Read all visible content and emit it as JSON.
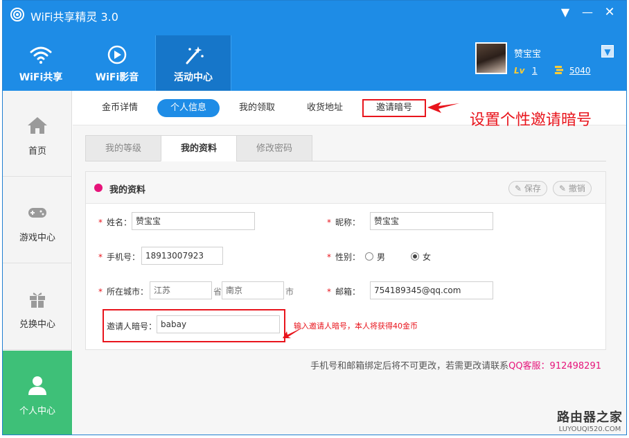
{
  "app": {
    "title": "WiFi共享精灵 3.0",
    "window_controls": {
      "dropdown": "▼",
      "minimize": "—",
      "close": "✕"
    }
  },
  "nav": [
    {
      "label": "WiFi共享",
      "icon": "wifi-icon"
    },
    {
      "label": "WiFi影音",
      "icon": "play-icon"
    },
    {
      "label": "活动中心",
      "icon": "magic-wand-icon",
      "active": true
    }
  ],
  "user": {
    "name": "赞宝宝",
    "lv_badge": "Lv",
    "level": "1",
    "coins": "5040"
  },
  "sidebar": [
    {
      "label": "首页",
      "icon": "home-icon"
    },
    {
      "label": "游戏中心",
      "icon": "gamepad-icon"
    },
    {
      "label": "兑换中心",
      "icon": "gift-icon"
    },
    {
      "label": "个人中心",
      "icon": "person-icon",
      "active": true
    }
  ],
  "subtabs": [
    "金币详情",
    "个人信息",
    "我的领取",
    "收货地址",
    "邀请暗号"
  ],
  "annotation": "设置个性邀请暗号",
  "inner_tabs": [
    "我的等级",
    "我的资料",
    "修改密码"
  ],
  "profile": {
    "title": "我的资料",
    "save": "保存",
    "cancel": "撤销",
    "name_label": "姓名：",
    "name_value": "赞宝宝",
    "nickname_label": "昵称：",
    "nickname_value": "赞宝宝",
    "phone_label": "手机号：",
    "phone_value": "18913007923",
    "gender_label": "性别：",
    "gender_male": "男",
    "gender_female": "女",
    "city_label": "所在城市：",
    "province_value": "江苏",
    "province_suffix": "省",
    "city_value": "南京",
    "city_suffix": "市",
    "email_label": "邮箱：",
    "email_value": "754189345@qq.com",
    "invite_label": "邀请人暗号：",
    "invite_value": "babay",
    "invite_hint": "输入邀请人暗号，本人将获得40金币"
  },
  "bottom_note": {
    "text": "手机号和邮箱绑定后将不可更改，若需更改请联系",
    "qq": "QQ客服：912498291"
  },
  "watermark": {
    "cn": "路由器之家",
    "en": "LUYOUQI520.COM"
  },
  "colors": {
    "header": "#1e8ce6",
    "accent_green": "#3ec078",
    "annotation_red": "#e8141c",
    "pink": "#e6147a"
  }
}
